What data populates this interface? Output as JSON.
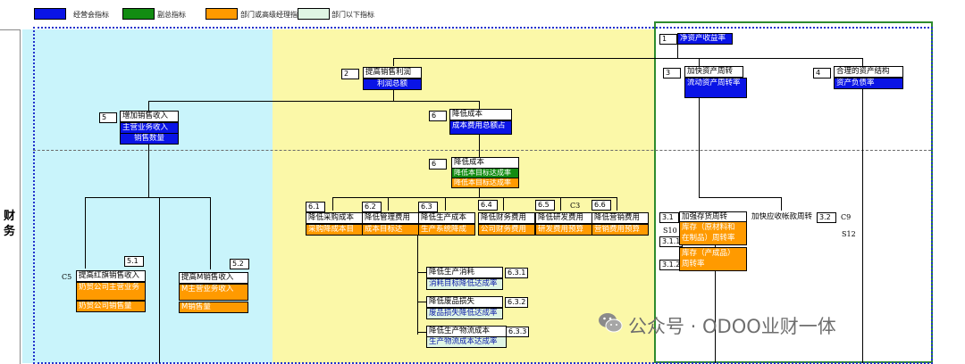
{
  "legend": [
    {
      "label": "经营会指标",
      "color": "#0a14e6"
    },
    {
      "label": "副总指标",
      "color": "#128c12"
    },
    {
      "label": "部门或高级经理指标",
      "color": "#ff9a00"
    },
    {
      "label": "部门以下指标",
      "color": "#dff5e4"
    }
  ],
  "side_label": "财务",
  "nodes": {
    "n1": {
      "num": "1",
      "cells": [
        "净资产收益率"
      ]
    },
    "n2": {
      "num": "2",
      "title": "提高销售利润",
      "cells": [
        "利润总额"
      ]
    },
    "n3": {
      "num": "3",
      "title": "加快资产周转",
      "cells": [
        "流动资产周转率"
      ]
    },
    "n4": {
      "num": "4",
      "title": "合理的资产结构",
      "cells": [
        "资产负债率"
      ]
    },
    "n5": {
      "num": "5",
      "title": "增加销售收入",
      "cells": [
        "主营业务收入",
        "销售数量"
      ]
    },
    "n6a": {
      "num": "6",
      "title": "降低成本",
      "cells": [
        "成本费用总额占"
      ]
    },
    "n6b": {
      "num": "6",
      "title": "降低成本",
      "cells": [
        "降低本目标达成率",
        "降低本目标达成率"
      ]
    },
    "n51": {
      "num": "5.1",
      "code": "C5",
      "title": "提高红旗销售收入",
      "cells": [
        "奶贸公司主营业务",
        "奶贸公司销售量"
      ]
    },
    "n52": {
      "num": "5.2",
      "title": "提高M销售收入",
      "cells": [
        "M主营业务收入",
        "M销售量"
      ]
    },
    "n61": {
      "num": "6.1",
      "title": "降低采购成本",
      "cells": [
        "采购降成本目"
      ]
    },
    "n62": {
      "num": "6.2",
      "title": "降低管理费用",
      "cells": [
        "成本目标达"
      ]
    },
    "n63": {
      "num": "6.3",
      "title": "降低生产成本",
      "cells": [
        "生产系统降成"
      ]
    },
    "n64": {
      "num": "6.4",
      "title": "降低财务费用",
      "cells": [
        "公司财务费用"
      ]
    },
    "n65": {
      "num": "6.5",
      "code": "C3",
      "title": "降低研发费用",
      "cells": [
        "研发费用预算"
      ]
    },
    "n66": {
      "num": "6.6",
      "title": "降低营销费用",
      "cells": [
        "营销费用预算"
      ]
    },
    "n631": {
      "num": "6.3.1",
      "title": "降低生产消耗",
      "cells": [
        "消耗目标降低达成率"
      ]
    },
    "n632": {
      "num": "6.3.2",
      "title": "降低废品损失",
      "cells": [
        "废品损失降低达成率"
      ]
    },
    "n633": {
      "num": "6.3.3",
      "title": "降低生产物流成本",
      "cells": [
        "生产物流成本达成率"
      ]
    },
    "n31": {
      "num": "3.1",
      "title": "加强存货周转",
      "code": "S10"
    },
    "n311": {
      "num": "3.1.1",
      "cells": [
        "库存（原材料和",
        "在制品）周转率"
      ]
    },
    "n312": {
      "num": "3.1.2",
      "cells": [
        "库存（产成品）",
        "周转率"
      ]
    },
    "n32": {
      "num": "3.2",
      "title": "加快应收帐款周转",
      "code": "C9",
      "code2": "S12"
    }
  },
  "watermark": "公众号 · ODOO业财一体"
}
